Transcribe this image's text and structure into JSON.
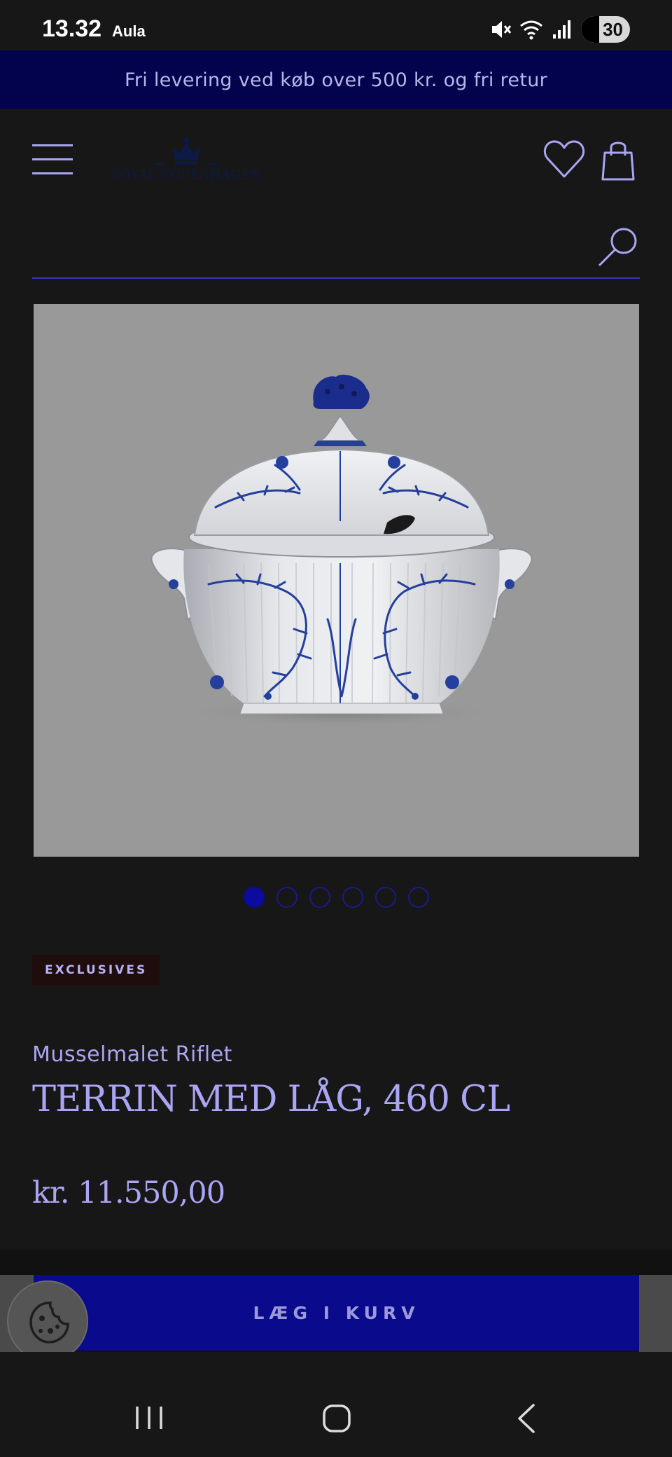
{
  "status_bar": {
    "time": "13.32",
    "app": "Aula",
    "battery": "30",
    "icons": [
      "mute-icon",
      "wifi-icon",
      "signal-icon"
    ]
  },
  "banner": {
    "text": "Fri levering ved køb over 500 kr. og fri retur"
  },
  "header": {
    "logo_text": "ROYAL COPENHAGEN",
    "icons": [
      "menu-icon",
      "heart-icon",
      "shopping-bag-icon"
    ]
  },
  "search": {
    "placeholder": "",
    "icon": "search-icon"
  },
  "gallery": {
    "total_images": 6,
    "active_index": 0
  },
  "product": {
    "badge": "EXCLUSIVES",
    "collection": "Musselmalet Riflet",
    "title": "TERRIN MED LÅG, 460 CL",
    "price": "kr. 11.550,00"
  },
  "cart": {
    "add_label": "LÆG I KURV"
  },
  "colors": {
    "accent": "#0a0a8d",
    "banner_bg": "#02024d",
    "text": "#a9a5f2",
    "background": "#171718"
  },
  "nav_bar": {
    "icons": [
      "recent-apps-icon",
      "home-icon",
      "back-icon"
    ]
  }
}
